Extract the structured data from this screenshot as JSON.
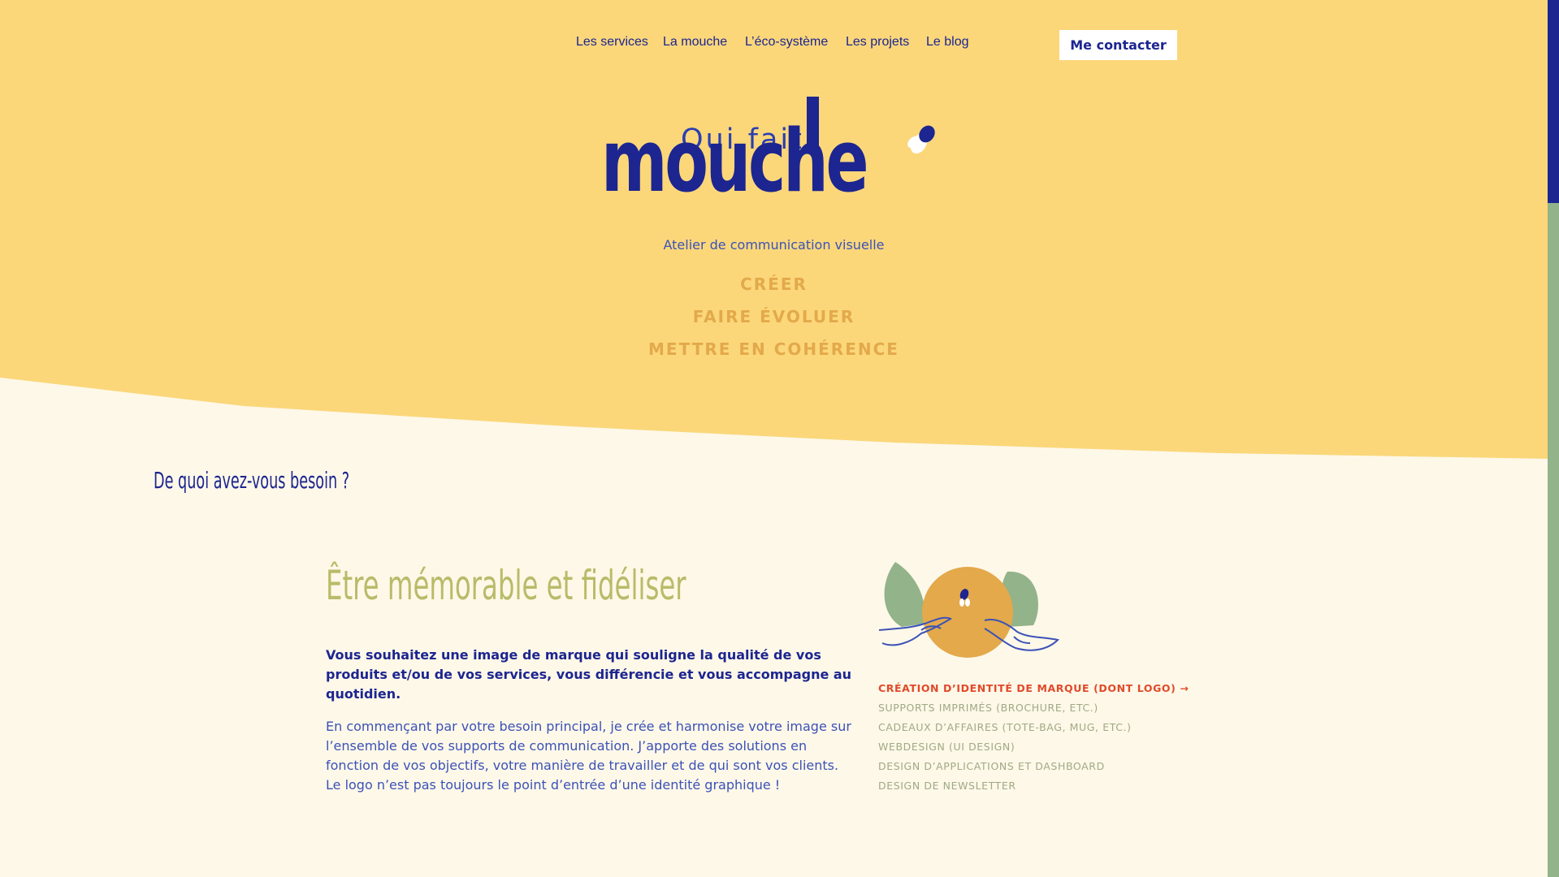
{
  "nav": {
    "items": [
      {
        "label": "Les services"
      },
      {
        "label": "La mouche"
      },
      {
        "label": "L’éco-système"
      },
      {
        "label": "Les projets"
      },
      {
        "label": "Le blog"
      }
    ],
    "contact_label": "Me contacter"
  },
  "logo": {
    "line1": "Qui fait",
    "line2": "mouche",
    "icon": "fly-icon"
  },
  "tagline": "Atelier de communication visuelle",
  "verbs": [
    "CRÉER",
    "FAIRE ÉVOLUER",
    "METTRE EN COHÉRENCE"
  ],
  "needs_title": "De quoi avez-vous besoin ?",
  "service": {
    "title": "Être mémorable et fidéliser",
    "lead": "Vous souhaitez une image de marque qui souligne la qualité de vos produits et/ou de vos services, vous différencie et vous accompagne au quotidien.",
    "body": "En commençant par votre besoin principal, je crée et harmonise votre image sur l’ensemble de vos supports de communication. J’apporte des solutions en fonction de vos objectifs, votre manière de travailler et de qui sont vos clients. Le logo n’est pas toujours le point d’entrée d’une identité graphique !",
    "illustration": "orange-with-leaves-illustration",
    "items": [
      {
        "label": "CRÉATION D’IDENTITÉ DE MARQUE (DONT LOGO) →",
        "active": true
      },
      {
        "label": "SUPPORTS IMPRIMÉS (BROCHURE, ETC.)",
        "active": false
      },
      {
        "label": "CADEAUX D’AFFAIRES (TOTE-BAG, MUG, ETC.)",
        "active": false
      },
      {
        "label": "WEBDESIGN (UI DESIGN)",
        "active": false
      },
      {
        "label": "DESIGN D’APPLICATIONS ET DASHBOARD",
        "active": false
      },
      {
        "label": "DESIGN DE NEWSLETTER",
        "active": false
      }
    ]
  },
  "colors": {
    "hero_bg": "#fbd77a",
    "page_bg": "#fef8e8",
    "navy": "#1c2590",
    "blue": "#3b52b8",
    "mustard": "#e3a94a",
    "olive": "#b9bb69",
    "sage": "#93b38a",
    "accent_red": "#e04a2a"
  }
}
